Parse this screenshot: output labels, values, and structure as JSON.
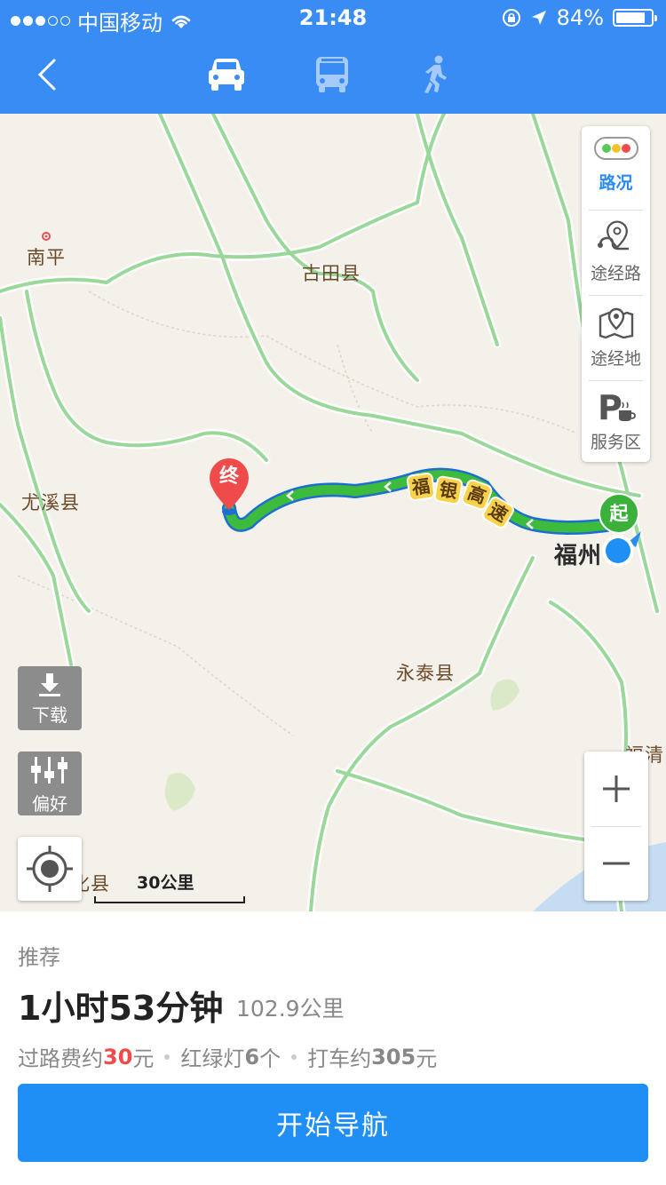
{
  "status_bar": {
    "carrier": "中国移动",
    "time": "21:48",
    "battery": "84%",
    "battery_level": 0.84
  },
  "nav": {
    "back_icon": "chevron-left-icon",
    "modes": [
      {
        "name": "car",
        "icon": "car-icon",
        "active": true
      },
      {
        "name": "bus",
        "icon": "bus-icon",
        "active": false
      },
      {
        "name": "walk",
        "icon": "walking-icon",
        "active": false
      }
    ]
  },
  "map": {
    "places": {
      "nanping": "南平",
      "gutian": "古田县",
      "youxi": "尤溪县",
      "yongtai": "永泰县",
      "fuzhou": "福州",
      "fuqing": "福清",
      "partial_county": "化县"
    },
    "highway_label": [
      "福",
      "银",
      "高",
      "速"
    ],
    "end_marker": "终",
    "start_marker": "起",
    "side_panel": {
      "traffic": "路况",
      "via_route": "途经路",
      "via_place": "途经地",
      "service_area": "服务区"
    },
    "download": "下载",
    "preference": "偏好",
    "scale": "30公里"
  },
  "route": {
    "recommend": "推荐",
    "duration": "1小时53分钟",
    "distance": "102.9公里",
    "toll_prefix": "过路费约",
    "toll_amount": "30",
    "toll_unit": "元",
    "lights_prefix": "红绿灯",
    "lights_count": "6",
    "lights_unit": "个",
    "taxi_prefix": "打车约",
    "taxi_amount": "305",
    "taxi_unit": "元",
    "start_button": "开始导航"
  },
  "colors": {
    "primary": "#3a8cf5",
    "route": "#3dbb3d",
    "highlight": "#f04a4a"
  }
}
